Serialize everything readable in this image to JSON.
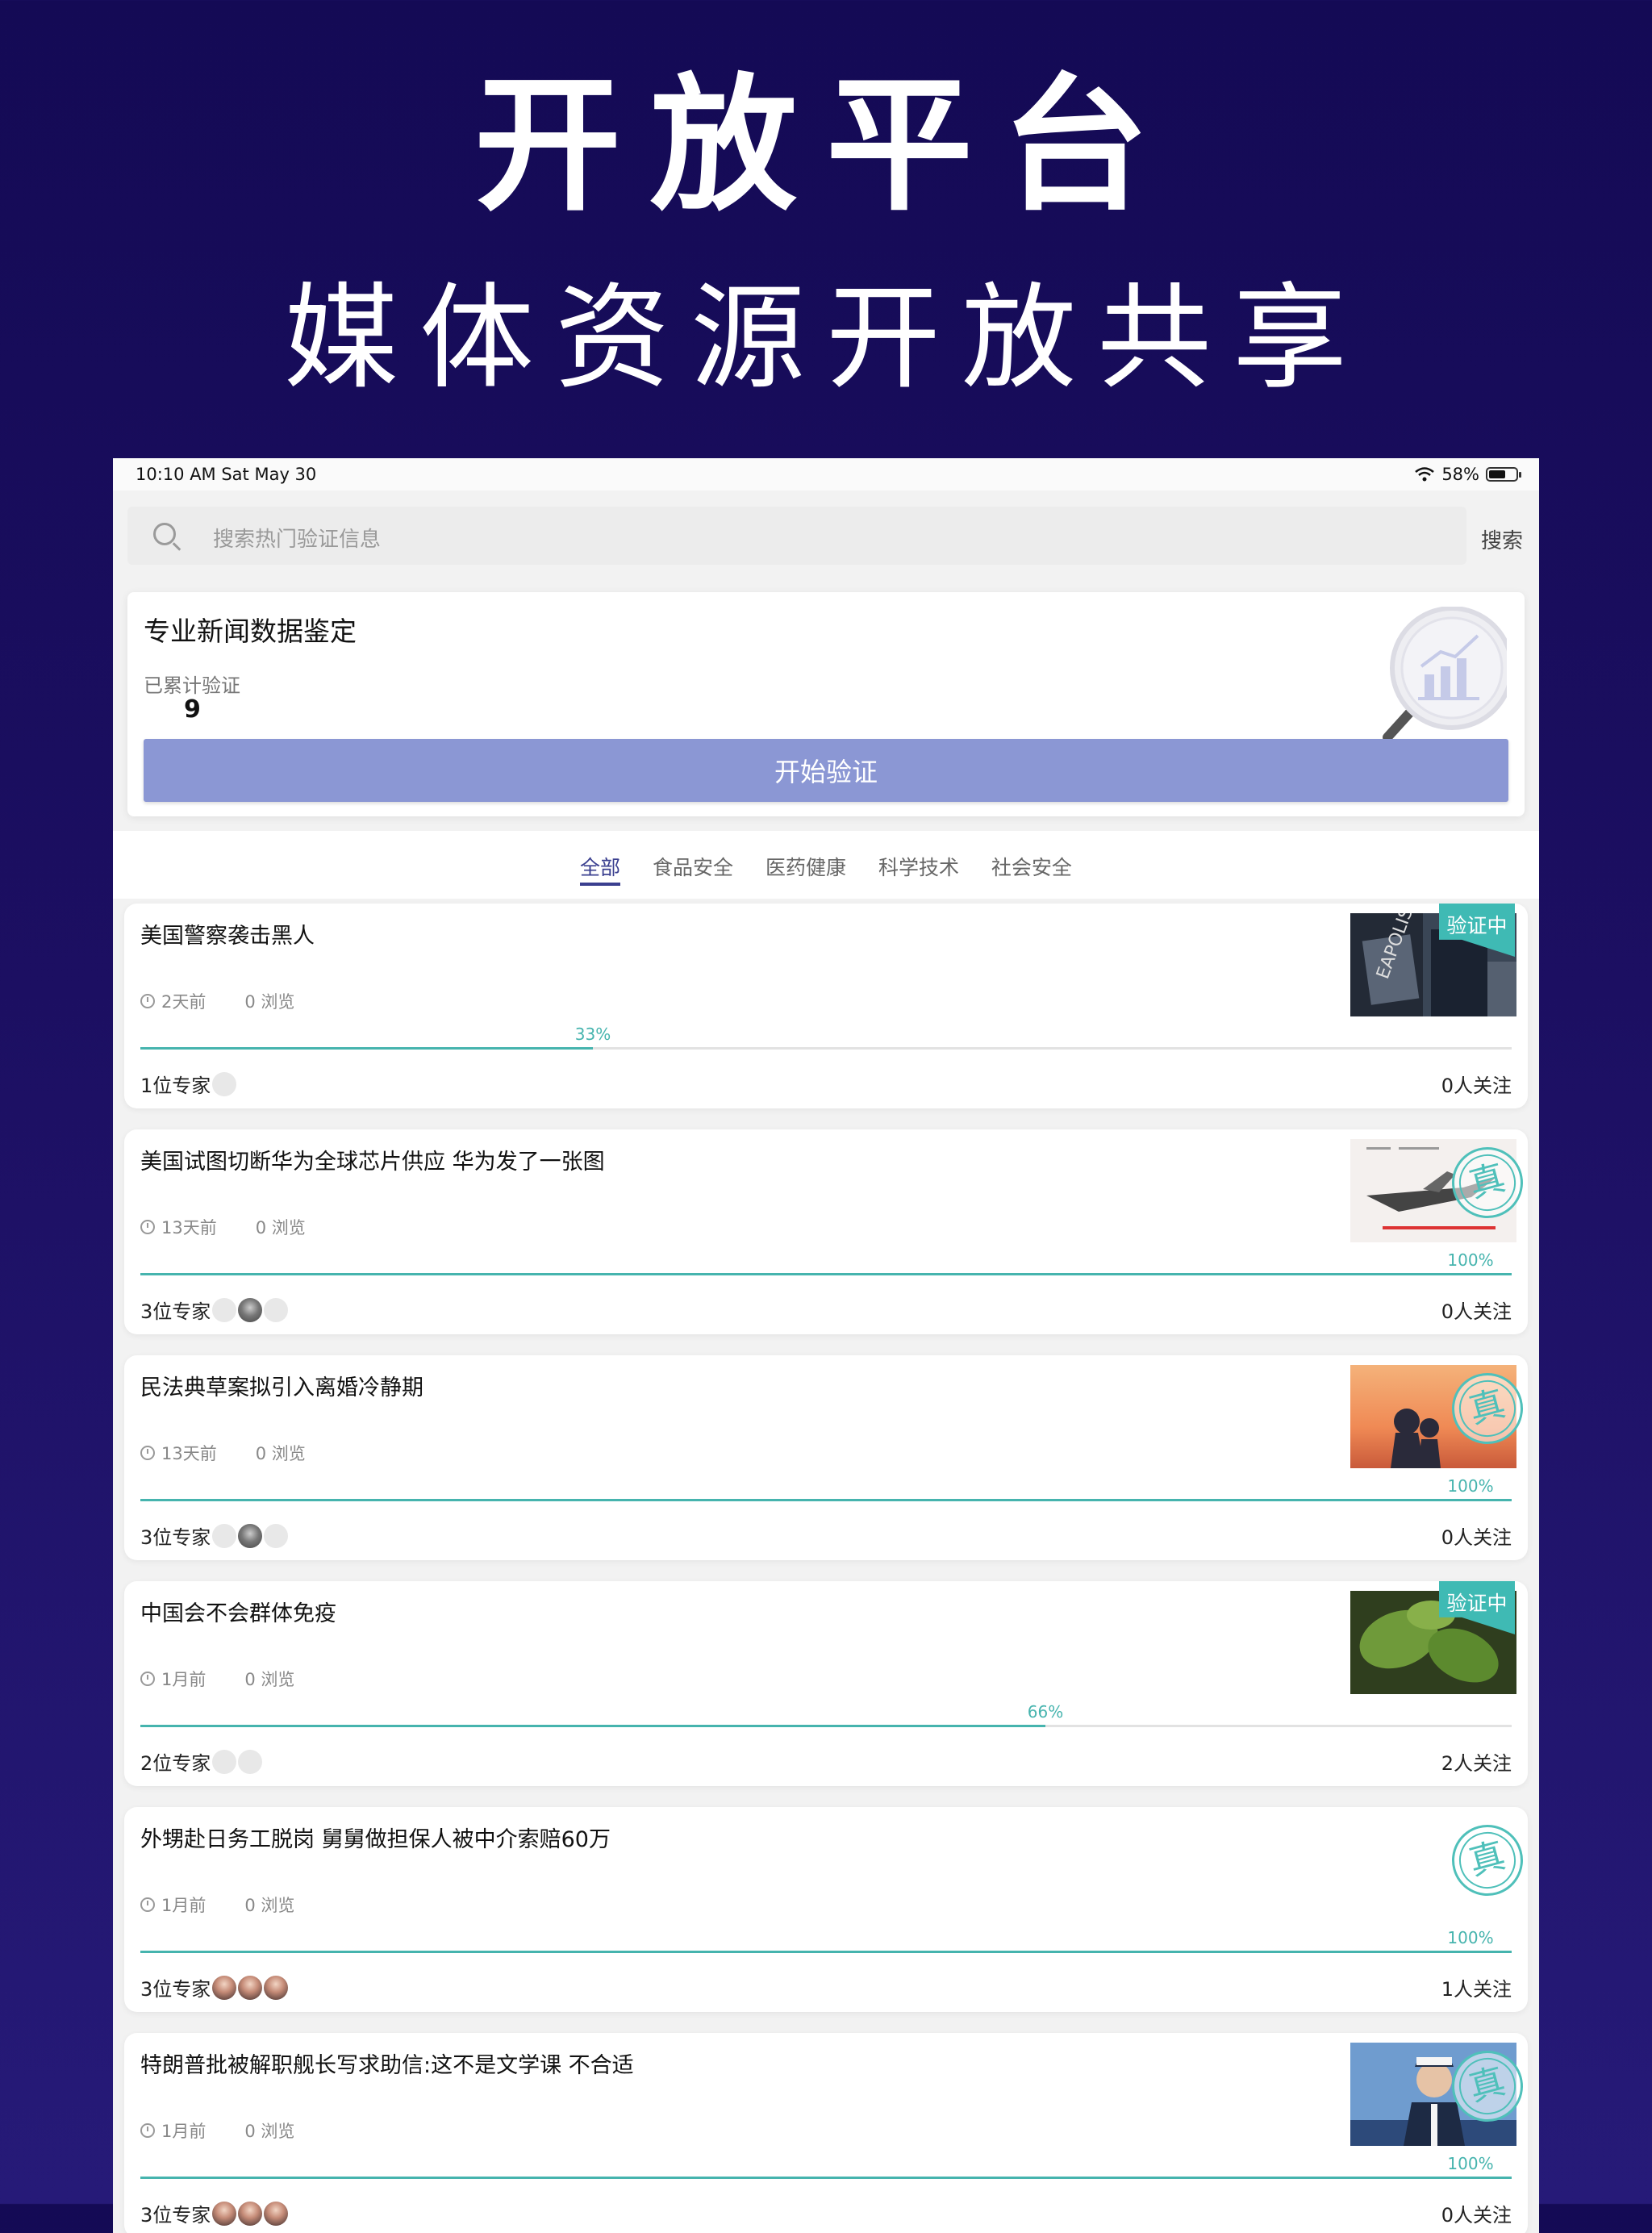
{
  "hero": {
    "title": "开放平台",
    "subtitle": "媒体资源开放共享"
  },
  "statusbar": {
    "time": "10:10 AM   Sat May 30",
    "battery": "58%"
  },
  "search": {
    "placeholder": "搜索热门验证信息",
    "button": "搜索"
  },
  "summary": {
    "title": "专业新闻数据鉴定",
    "count_label": "已累计验证",
    "count": "9",
    "start_button": "开始验证"
  },
  "tabs": [
    "全部",
    "食品安全",
    "医药健康",
    "科学技术",
    "社会安全"
  ],
  "colors": {
    "accent": "#46b4ae",
    "button": "#8b97d4",
    "tab_active": "#3a3f8f",
    "background": "#140a55"
  },
  "items": [
    {
      "title": "美国警察袭击黑人",
      "time": "2天前",
      "views": "0 浏览",
      "progress": 33,
      "progress_label": "33%",
      "experts": "1位专家",
      "follows": "0人关注",
      "status": "验证中",
      "thumb": "police"
    },
    {
      "title": "美国试图切断华为全球芯片供应 华为发了一张图",
      "time": "13天前",
      "views": "0 浏览",
      "progress": 100,
      "progress_label": "100%",
      "experts": "3位专家",
      "follows": "0人关注",
      "status": "真",
      "thumb": "plane"
    },
    {
      "title": "民法典草案拟引入离婚冷静期",
      "time": "13天前",
      "views": "0 浏览",
      "progress": 100,
      "progress_label": "100%",
      "experts": "3位专家",
      "follows": "0人关注",
      "status": "真",
      "thumb": "sunset"
    },
    {
      "title": "中国会不会群体免疫",
      "time": "1月前",
      "views": "0 浏览",
      "progress": 66,
      "progress_label": "66%",
      "experts": "2位专家",
      "follows": "2人关注",
      "status": "验证中",
      "thumb": "leaf"
    },
    {
      "title": "外甥赴日务工脱岗 舅舅做担保人被中介索赔60万",
      "time": "1月前",
      "views": "0 浏览",
      "progress": 100,
      "progress_label": "100%",
      "experts": "3位专家",
      "follows": "1人关注",
      "status": "真",
      "thumb": ""
    },
    {
      "title": "特朗普批被解职舰长写求助信:这不是文学课 不合适",
      "time": "1月前",
      "views": "0 浏览",
      "progress": 100,
      "progress_label": "100%",
      "experts": "3位专家",
      "follows": "0人关注",
      "status": "真",
      "thumb": "navy"
    }
  ]
}
